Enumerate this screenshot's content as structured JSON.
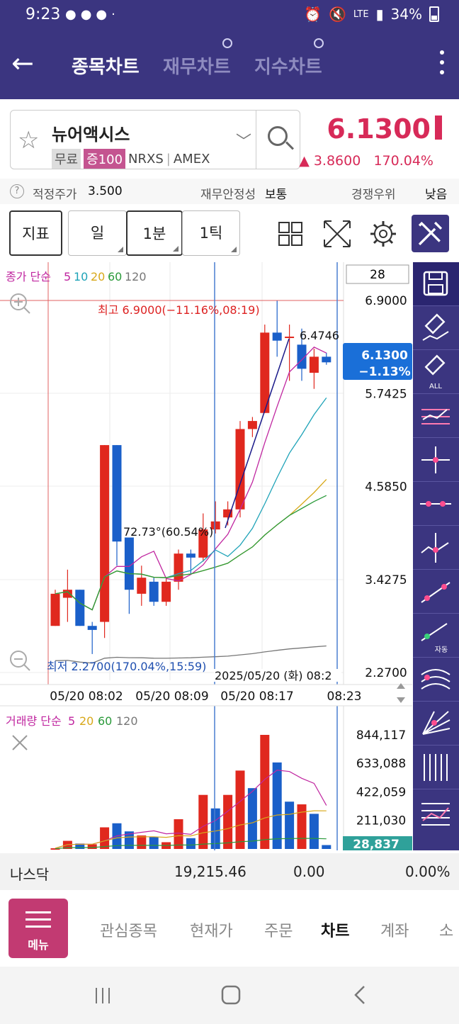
{
  "status": {
    "time": "9:23",
    "battery": "34%",
    "net": "LTE"
  },
  "header": {
    "tabs": [
      "종목차트",
      "재무차트",
      "지수차트"
    ],
    "active_tab": 0
  },
  "stock": {
    "name": "뉴어액시스",
    "tag_free": "무료",
    "tag_margin": "증100",
    "ticker": "NRXS",
    "exchange": "AMEX",
    "price": "6.1300",
    "change": "▲ 3.8600",
    "change_pct": "170.04%"
  },
  "info": {
    "fair_label": "적정주가",
    "fair_value": "3.500",
    "stability_label": "재무안정성",
    "stability_value": "보통",
    "competition_label": "경쟁우위",
    "competition_value": "낮음"
  },
  "toolbar": {
    "indicator": "지표",
    "period_day": "일",
    "period_1m": "1분",
    "period_1t": "1틱"
  },
  "chart_labels": {
    "ma_legend_prefix": "종가 단순",
    "ma_periods": [
      "5",
      "10",
      "20",
      "60",
      "120"
    ],
    "vol_legend_prefix": "거래량 단순",
    "vol_periods": [
      "5",
      "20",
      "60",
      "120"
    ],
    "count_box": "28",
    "high_label": "최고 6.9000(−11.16%,08:19)",
    "low_label": "최저 2.2700(170.04%,15:59)",
    "angle_label": "72.73°(60.54%)",
    "point_label": "6.4746",
    "current_price": "6.1300",
    "current_pct": "−1.13%",
    "crosshair_time": "2025/05/20 (화) 08:2",
    "vol_current": "28,837"
  },
  "chart_data": {
    "type": "candlestick",
    "price_ticks": [
      "6.9000",
      "5.7425",
      "4.5850",
      "3.4275",
      "2.2700"
    ],
    "price_tick_values": [
      6.9,
      5.7425,
      4.585,
      3.4275,
      2.27
    ],
    "price_range": [
      2.27,
      6.9
    ],
    "volume_ticks": [
      "844,117",
      "633,088",
      "422,059",
      "211,030"
    ],
    "volume_tick_values": [
      844117,
      633088,
      422059,
      211030
    ],
    "time_labels": [
      "05/20 08:02",
      "05/20 08:09",
      "05/20 08:17",
      "08:23"
    ],
    "candles": [
      {
        "o": 2.85,
        "c": 3.25,
        "h": 3.3,
        "l": 2.85
      },
      {
        "o": 3.2,
        "c": 3.3,
        "h": 3.55,
        "l": 2.9
      },
      {
        "o": 3.3,
        "c": 2.85,
        "h": 3.3,
        "l": 2.85
      },
      {
        "o": 2.85,
        "c": 2.8,
        "h": 2.9,
        "l": 2.5
      },
      {
        "o": 2.9,
        "c": 5.1,
        "h": 5.1,
        "l": 2.7
      },
      {
        "o": 5.1,
        "c": 3.9,
        "h": 5.1,
        "l": 3.6
      },
      {
        "o": 3.95,
        "c": 3.3,
        "h": 3.95,
        "l": 3.0
      },
      {
        "o": 3.25,
        "c": 3.45,
        "h": 3.6,
        "l": 3.1
      },
      {
        "o": 3.4,
        "c": 3.15,
        "h": 3.45,
        "l": 3.1
      },
      {
        "o": 3.15,
        "c": 3.4,
        "h": 3.45,
        "l": 3.1
      },
      {
        "o": 3.4,
        "c": 3.75,
        "h": 3.8,
        "l": 3.3
      },
      {
        "o": 3.75,
        "c": 3.7,
        "h": 3.8,
        "l": 3.5
      },
      {
        "o": 3.7,
        "c": 4.05,
        "h": 4.25,
        "l": 3.65
      },
      {
        "o": 4.05,
        "c": 4.15,
        "h": 4.4,
        "l": 4.0
      },
      {
        "o": 4.2,
        "c": 4.3,
        "h": 4.4,
        "l": 4.1
      },
      {
        "o": 4.3,
        "c": 5.3,
        "h": 5.4,
        "l": 4.2
      },
      {
        "o": 5.3,
        "c": 5.4,
        "h": 5.45,
        "l": 5.2
      },
      {
        "o": 5.5,
        "c": 6.5,
        "h": 6.6,
        "l": 5.5
      },
      {
        "o": 6.5,
        "c": 6.4,
        "h": 6.9,
        "l": 6.2
      },
      {
        "o": 6.45,
        "c": 6.45,
        "h": 6.6,
        "l": 5.9
      },
      {
        "o": 6.35,
        "c": 6.05,
        "h": 6.55,
        "l": 5.9
      },
      {
        "o": 6.0,
        "c": 6.2,
        "h": 6.3,
        "l": 5.8
      },
      {
        "o": 6.2,
        "c": 6.13,
        "h": 6.25,
        "l": 6.1
      }
    ],
    "volumes": [
      {
        "v": 5000,
        "up": true
      },
      {
        "v": 60000,
        "up": true
      },
      {
        "v": 40000,
        "up": false
      },
      {
        "v": 35000,
        "up": true
      },
      {
        "v": 160000,
        "up": true
      },
      {
        "v": 190000,
        "up": false
      },
      {
        "v": 130000,
        "up": false
      },
      {
        "v": 100000,
        "up": true
      },
      {
        "v": 90000,
        "up": false
      },
      {
        "v": 50000,
        "up": true
      },
      {
        "v": 220000,
        "up": true
      },
      {
        "v": 80000,
        "up": false
      },
      {
        "v": 400000,
        "up": true
      },
      {
        "v": 300000,
        "up": false
      },
      {
        "v": 400000,
        "up": true
      },
      {
        "v": 580000,
        "up": true
      },
      {
        "v": 450000,
        "up": false
      },
      {
        "v": 844117,
        "up": true
      },
      {
        "v": 640000,
        "up": false
      },
      {
        "v": 350000,
        "up": false
      },
      {
        "v": 330000,
        "up": true
      },
      {
        "v": 260000,
        "up": false
      },
      {
        "v": 28837,
        "up": false
      }
    ],
    "ma_colors": {
      "5": "#c026a0",
      "10": "#1fa3b8",
      "20": "#d8a81a",
      "60": "#2a9a3a",
      "120": "#777777"
    }
  },
  "index": {
    "name": "나스닥",
    "value": "19,215.46",
    "change": "0.00",
    "pct": "0.00%"
  },
  "nav": {
    "menu": "메뉴",
    "items": [
      "관심종목",
      "현재가",
      "주문",
      "차트",
      "계좌",
      "소"
    ],
    "active": 3
  }
}
